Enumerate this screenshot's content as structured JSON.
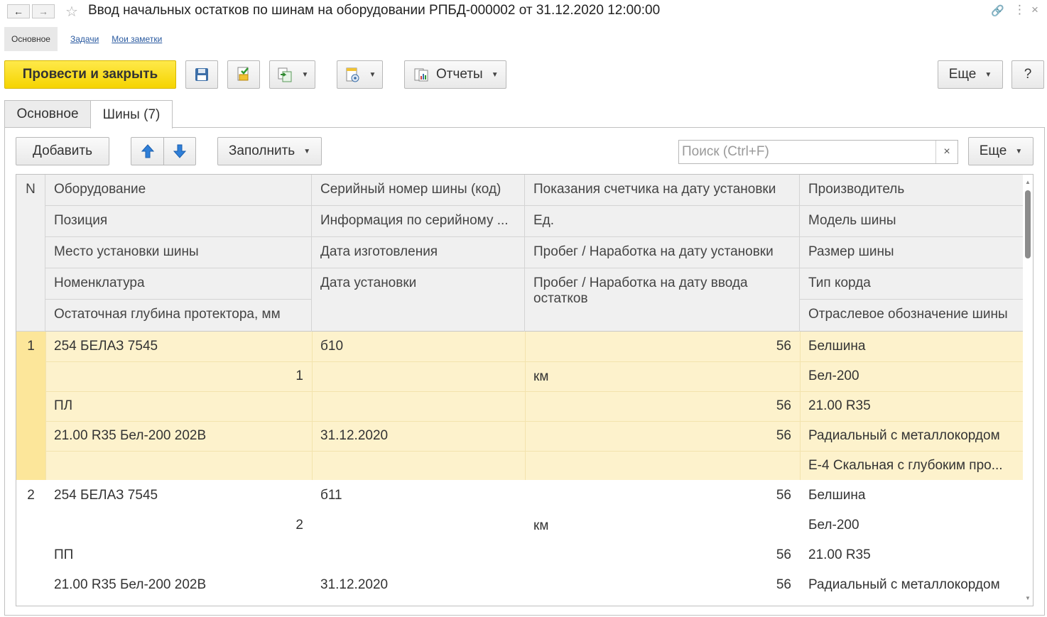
{
  "window": {
    "title": "Ввод начальных остатков по шинам на оборудовании РПБД-000002 от 31.12.2020 12:00:00",
    "back_icon": "arrow-left-icon",
    "forward_icon": "arrow-right-icon",
    "favorite_icon": "star-icon"
  },
  "sections": {
    "main": "Основное",
    "tasks": "Задачи",
    "notes": "Мои заметки"
  },
  "toolbar": {
    "post_close": "Провести и закрыть",
    "reports": "Отчеты",
    "more": "Еще",
    "help": "?"
  },
  "tabs": {
    "main": "Основное",
    "tires": "Шины (7)"
  },
  "table_toolbar": {
    "add": "Добавить",
    "fill": "Заполнить",
    "more": "Еще",
    "search_placeholder": "Поиск (Ctrl+F)",
    "clear": "×"
  },
  "columns": {
    "n": "N",
    "c1": [
      "Оборудование",
      "Позиция",
      "Место установки шины",
      "Номенклатура",
      "Остаточная глубина протектора, мм"
    ],
    "c2": [
      "Серийный номер шины (код)",
      "Информация по серийному ...",
      "Дата изготовления",
      "Дата установки"
    ],
    "c3": [
      "Показания счетчика на дату установки",
      "Ед.",
      "Пробег / Наработка на дату установки",
      "Пробег / Наработка на дату ввода остатков"
    ],
    "c4": [
      "Производитель",
      "Модель шины",
      "Размер шины",
      "Тип корда",
      "Отраслевое обозначение шины"
    ]
  },
  "rows": [
    {
      "n": "1",
      "equipment": "254 БЕЛАЗ 7545",
      "position": "1",
      "place": "ПЛ",
      "nomenclature": "21.00 R35  Бел-200  202В",
      "depth": "",
      "serial": "б10",
      "serial_info": "",
      "made_date": "",
      "install_date": "31.12.2020",
      "counter": "56",
      "unit": "км",
      "run_install": "56",
      "run_input": "56",
      "maker": "Белшина",
      "model": "Бел-200",
      "size": "21.00 R35",
      "cord": "Радиальный с металлокордом",
      "industry": "Е-4 Скальная с глубоким про..."
    },
    {
      "n": "2",
      "equipment": "254 БЕЛАЗ 7545",
      "position": "2",
      "place": "ПП",
      "nomenclature": "21.00 R35  Бел-200  202В",
      "serial": "б11",
      "install_date": "31.12.2020",
      "counter": "56",
      "unit": "км",
      "run_install": "56",
      "run_input": "56",
      "maker": "Белшина",
      "model": "Бел-200",
      "size": "21.00 R35",
      "cord": "Радиальный с металлокордом"
    }
  ]
}
